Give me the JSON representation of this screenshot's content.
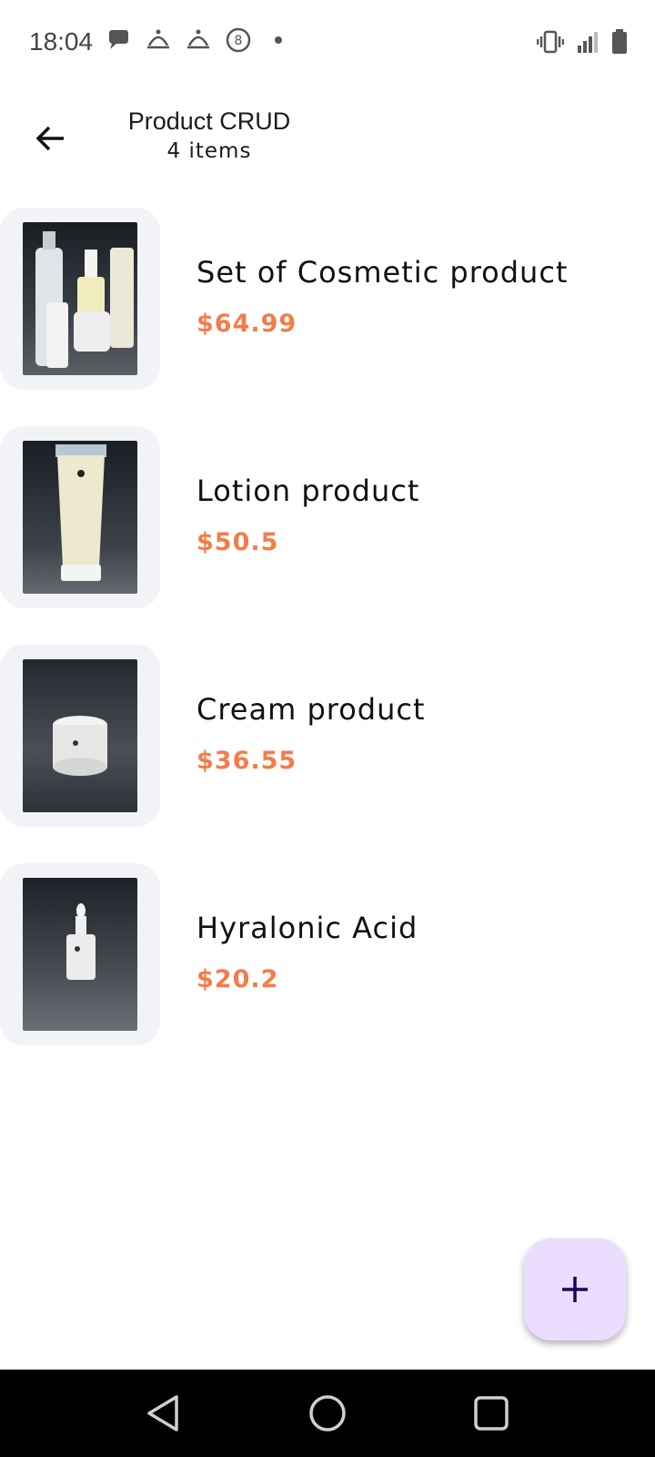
{
  "status_bar": {
    "time": "18:04",
    "left_icons": [
      "chat-icon",
      "lamp-icon",
      "lamp-icon",
      "circled-8-icon",
      "dot-icon"
    ],
    "right_icons": [
      "vibrate-icon",
      "signal-icon",
      "battery-icon"
    ]
  },
  "app_bar": {
    "title": "Product CRUD",
    "subtitle": "4 items",
    "back_icon": "arrow-left-icon"
  },
  "products": [
    {
      "name": "Set of Cosmetic product",
      "price": "$64.99"
    },
    {
      "name": "Lotion product",
      "price": "$50.5"
    },
    {
      "name": "Cream product",
      "price": "$36.55"
    },
    {
      "name": "Hyralonic Acid",
      "price": "$20.2"
    }
  ],
  "fab": {
    "icon": "plus-icon"
  },
  "colors": {
    "price": "#f47c48",
    "thumb_card": "#f2f3f7",
    "fab_bg": "#eaddff",
    "fab_icon": "#21005d"
  },
  "nav_bar": {
    "icons": [
      "back-triangle-icon",
      "home-circle-icon",
      "recents-square-icon"
    ]
  }
}
